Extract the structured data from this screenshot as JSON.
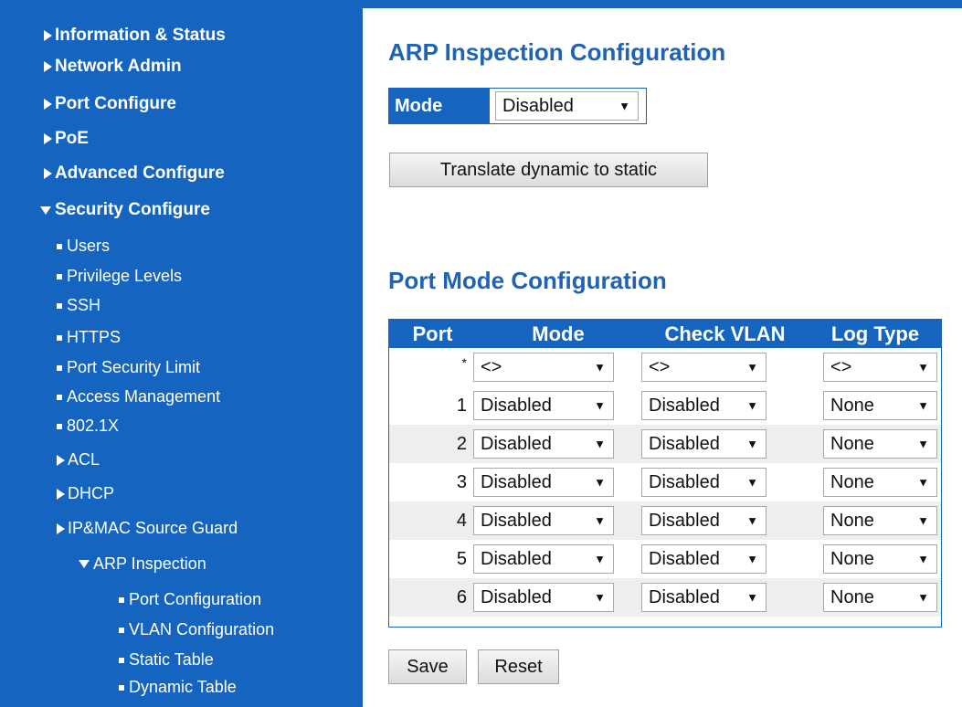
{
  "sidebar": {
    "items": [
      {
        "label": "Information & Status",
        "arrow": "right"
      },
      {
        "label": "Network Admin",
        "arrow": "right"
      },
      {
        "label": "Port Configure",
        "arrow": "right"
      },
      {
        "label": "PoE",
        "arrow": "right"
      },
      {
        "label": "Advanced Configure",
        "arrow": "right"
      },
      {
        "label": "Security Configure",
        "arrow": "down"
      },
      {
        "label": "Users"
      },
      {
        "label": "Privilege Levels"
      },
      {
        "label": "SSH"
      },
      {
        "label": "HTTPS"
      },
      {
        "label": "Port Security Limit"
      },
      {
        "label": "Access Management"
      },
      {
        "label": "802.1X"
      },
      {
        "label": "ACL",
        "arrow": "right"
      },
      {
        "label": "DHCP",
        "arrow": "right"
      },
      {
        "label": "IP&MAC Source Guard",
        "arrow": "right"
      },
      {
        "label": "ARP Inspection",
        "arrow": "down"
      },
      {
        "label": "Port Configuration"
      },
      {
        "label": "VLAN Configuration"
      },
      {
        "label": "Static Table"
      },
      {
        "label": "Dynamic Table"
      }
    ]
  },
  "main": {
    "title": "ARP Inspection Configuration",
    "mode_label": "Mode",
    "mode_value": "Disabled",
    "translate_button": "Translate dynamic to static",
    "port_section_title": "Port Mode Configuration",
    "table": {
      "headers": [
        "Port",
        "Mode",
        "Check VLAN",
        "Log Type"
      ],
      "rows": [
        {
          "port": "*",
          "mode": "<>",
          "check_vlan": "<>",
          "log_type": "<>"
        },
        {
          "port": "1",
          "mode": "Disabled",
          "check_vlan": "Disabled",
          "log_type": "None"
        },
        {
          "port": "2",
          "mode": "Disabled",
          "check_vlan": "Disabled",
          "log_type": "None"
        },
        {
          "port": "3",
          "mode": "Disabled",
          "check_vlan": "Disabled",
          "log_type": "None"
        },
        {
          "port": "4",
          "mode": "Disabled",
          "check_vlan": "Disabled",
          "log_type": "None"
        },
        {
          "port": "5",
          "mode": "Disabled",
          "check_vlan": "Disabled",
          "log_type": "None"
        },
        {
          "port": "6",
          "mode": "Disabled",
          "check_vlan": "Disabled",
          "log_type": "None"
        }
      ]
    },
    "save_button": "Save",
    "reset_button": "Reset"
  },
  "colors": {
    "accent": "#1565c0",
    "title": "#1f63b6"
  },
  "icons": {
    "select_caret": "▼"
  }
}
